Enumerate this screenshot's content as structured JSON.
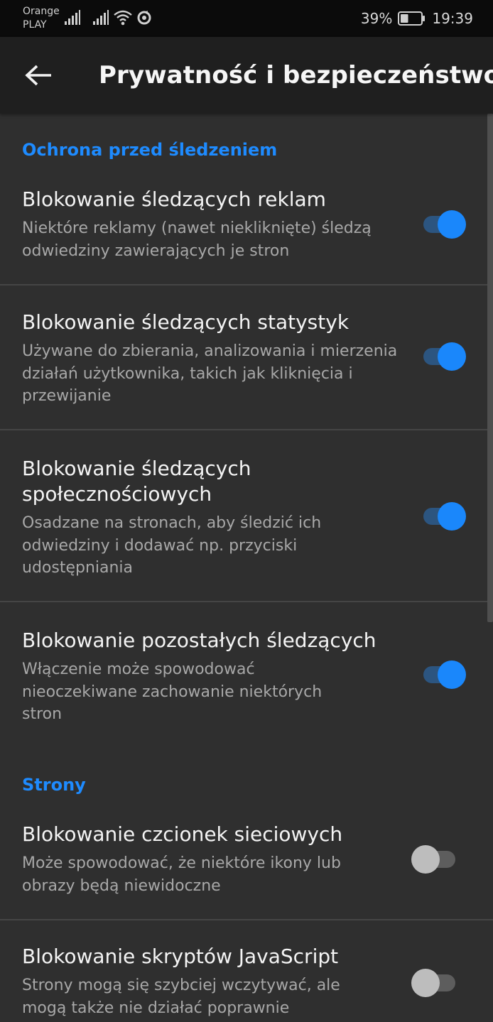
{
  "status_bar": {
    "carrier_line1": "Orange",
    "carrier_line2": "PLAY",
    "icons": [
      "signal-icon",
      "signal-icon",
      "wifi-icon",
      "data-saver-icon"
    ],
    "battery_percent": "39%",
    "battery_level": 0.39,
    "time": "19:39"
  },
  "app_bar": {
    "back_icon": "arrow-left-icon",
    "title": "Prywatność i bezpieczeństwo"
  },
  "sections": [
    {
      "header": "Ochrona przed śledzeniem",
      "items": [
        {
          "title": "Blokowanie śledzących reklam",
          "description": "Niektóre reklamy (nawet niekliknięte) śledzą odwiedziny zawierających je stron",
          "enabled": true
        },
        {
          "title": "Blokowanie śledzących statystyk",
          "description": "Używane do zbierania, analizowania i mierzenia działań użytkownika, takich jak kliknięcia i przewijanie",
          "enabled": true
        },
        {
          "title": "Blokowanie śledzących społecznościowych",
          "description": "Osadzane na stronach, aby śledzić ich odwiedziny i dodawać np. przyciski udostępniania",
          "enabled": true
        },
        {
          "title": "Blokowanie pozostałych śledzących",
          "description": "Włączenie może spowodować nieoczekiwane zachowanie niektórych stron",
          "enabled": true
        }
      ]
    },
    {
      "header": "Strony",
      "items": [
        {
          "title": "Blokowanie czcionek sieciowych",
          "description": "Może spowodować, że niektóre ikony lub obrazy będą niewidoczne",
          "enabled": false
        },
        {
          "title": "Blokowanie skryptów JavaScript",
          "description": "Strony mogą się szybciej wczytywać, ale mogą także nie działać poprawnie",
          "enabled": false
        }
      ]
    }
  ],
  "colors": {
    "background": "#2f2f2f",
    "app_bar": "#1f1f1f",
    "status_bar": "#0b0b0b",
    "accent": "#1a87fb",
    "section_header": "#1e8bff",
    "description": "#a8a8a8"
  }
}
